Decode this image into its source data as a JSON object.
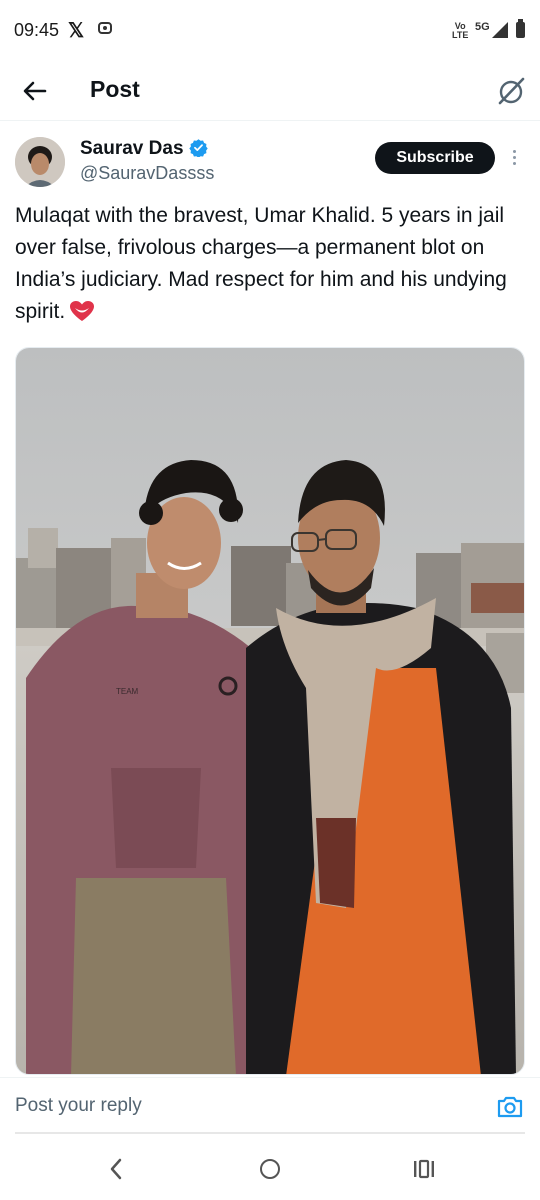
{
  "status_bar": {
    "time": "09:45",
    "x_icon": "x-logo-icon",
    "network_volte": "Vo)) LTE",
    "network_type": "5G"
  },
  "top_bar": {
    "title": "Post",
    "back_icon": "arrow-left-icon",
    "grok_icon": "grok-icon"
  },
  "author": {
    "display_name": "Saurav Das",
    "handle": "@SauravDassss",
    "verified": true,
    "subscribe_label": "Subscribe"
  },
  "post": {
    "text": "Mulaqat with the bravest, Umar Khalid. 5 years in jail over false, frivolous charges—a permanent blot on India’s judiciary. Mad respect for him and his undying spirit.",
    "emoji": "heart-emoji",
    "hoodie_print": "TEAM"
  },
  "reply": {
    "placeholder": "Post your reply",
    "camera_icon": "camera-icon"
  },
  "colors": {
    "accent": "#1d9bf0",
    "subscribe_bg": "#0f1419",
    "secondary_text": "#536471"
  }
}
